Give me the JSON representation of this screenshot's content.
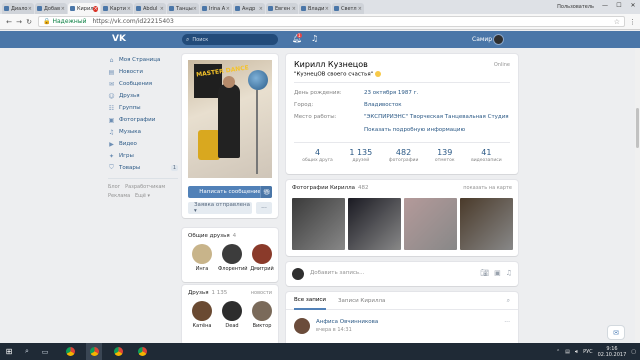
{
  "browser": {
    "tabs": [
      {
        "label": "Диало"
      },
      {
        "label": "Добав"
      },
      {
        "label": "Кирил",
        "active": true
      },
      {
        "label": "Карти"
      },
      {
        "label": "Abdul"
      },
      {
        "label": "Танцы"
      },
      {
        "label": "Irina A"
      },
      {
        "label": "Андр"
      },
      {
        "label": "Евген"
      },
      {
        "label": "Влади"
      },
      {
        "label": "Светл"
      }
    ],
    "user_label": "Пользователь",
    "secure_label": "Надежный",
    "url": "https://vk.com/id22215403",
    "window_controls": [
      "—",
      "☐",
      "✕"
    ]
  },
  "vk_header": {
    "logo": "VK",
    "search_placeholder": "Поиск",
    "notif_count": "1",
    "user_name": "Самир"
  },
  "left_menu": {
    "items": [
      {
        "label": "Моя Страница",
        "icon": "home-icon"
      },
      {
        "label": "Новости",
        "icon": "news-icon"
      },
      {
        "label": "Сообщения",
        "icon": "messages-icon"
      },
      {
        "label": "Друзья",
        "icon": "friends-icon"
      },
      {
        "label": "Группы",
        "icon": "groups-icon"
      },
      {
        "label": "Фотографии",
        "icon": "photos-icon"
      },
      {
        "label": "Музыка",
        "icon": "music-icon"
      },
      {
        "label": "Видео",
        "icon": "video-icon"
      },
      {
        "label": "Игры",
        "icon": "games-icon"
      },
      {
        "label": "Товары",
        "icon": "market-icon",
        "count": "1"
      }
    ],
    "footer": [
      "Блог",
      "Разработчикам",
      "Реклама",
      "Ещё ▾"
    ]
  },
  "profile": {
    "name": "Кирилл Кузнецов",
    "online": "Online",
    "status": "\"КузнецОВ своего счастья\"",
    "info": [
      {
        "key": "День рождения:",
        "value": "23 октября 1987 г."
      },
      {
        "key": "Город:",
        "value": "Владивосток"
      },
      {
        "key": "Место работы:",
        "value": "\"ЭКСПИРИЭНС\" Творческая Танцевальная Студия"
      }
    ],
    "more_info": "Показать подробную информацию",
    "counters": [
      {
        "n": "4",
        "label": "общих друга"
      },
      {
        "n": "1 135",
        "label": "друзей"
      },
      {
        "n": "482",
        "label": "фотографии"
      },
      {
        "n": "139",
        "label": "отметок"
      },
      {
        "n": "41",
        "label": "видеозаписи"
      }
    ],
    "avatar_text": "MASTER DANCE"
  },
  "actions": {
    "write_message": "Написать сообщение",
    "friend_request": "Заявка отправлена ▾",
    "more": "···"
  },
  "common_friends": {
    "title": "Общие друзья",
    "count": "4",
    "people": [
      {
        "name": "Инга",
        "color": "#c8b48a"
      },
      {
        "name": "Флорентий",
        "color": "#3c3c3c"
      },
      {
        "name": "Дмитрий",
        "color": "#8a3a2a"
      }
    ]
  },
  "friends": {
    "title": "Друзья",
    "count": "1 135",
    "link": "новости",
    "people": [
      {
        "name": "Катёна",
        "color": "#6a4a32"
      },
      {
        "name": "Dead",
        "color": "#2d2d2d"
      },
      {
        "name": "Виктор",
        "color": "#7a6a5a"
      }
    ]
  },
  "photos": {
    "title": "Фотографии Кирилла",
    "count": "482",
    "link": "показать на карте",
    "thumbs": [
      "#3a3a3a",
      "#1a1a22",
      "#b49a9a",
      "#4a3a2a",
      "#3d5a3a"
    ]
  },
  "post_box": {
    "placeholder": "Добавить запись..."
  },
  "wall": {
    "tabs": [
      "Все записи",
      "Записи Кирилла"
    ],
    "post_author": "Анфиса Овчинникова",
    "post_time": "вчера в 14:31"
  },
  "taskbar": {
    "lang": "РУС",
    "time": "9:16",
    "date": "02.10.2017",
    "apps": [
      {
        "icon": "chrome-icon",
        "color": "#db4437"
      },
      {
        "icon": "chrome-icon",
        "color": "#f4b400"
      },
      {
        "icon": "chrome-icon",
        "color": "#0f9d58"
      },
      {
        "icon": "chrome-icon",
        "color": "#4285f4"
      }
    ]
  }
}
